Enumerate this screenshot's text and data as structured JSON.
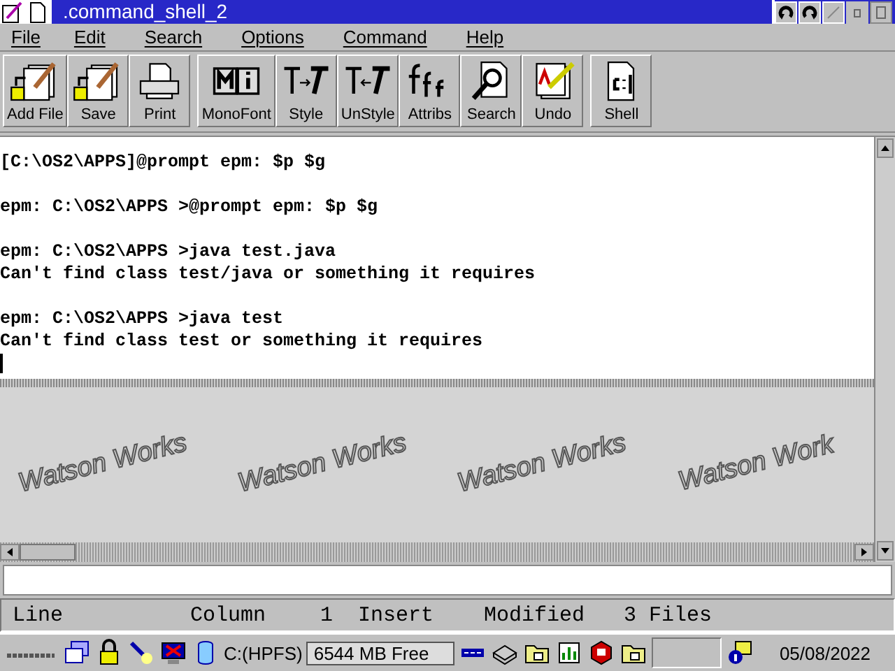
{
  "window": {
    "title": ".command_shell_2"
  },
  "menu": [
    "File",
    "Edit",
    "Search",
    "Options",
    "Command",
    "Help"
  ],
  "toolbar": [
    [
      {
        "label": "Add File",
        "kind": "addfile"
      },
      {
        "label": "Save",
        "kind": "save"
      },
      {
        "label": "Print",
        "kind": "print"
      }
    ],
    [
      {
        "label": "MonoFont",
        "kind": "mono"
      },
      {
        "label": "Style",
        "kind": "style"
      },
      {
        "label": "UnStyle",
        "kind": "unstyle"
      },
      {
        "label": "Attribs",
        "kind": "attribs"
      },
      {
        "label": "Search",
        "kind": "search"
      },
      {
        "label": "Undo",
        "kind": "undo"
      }
    ],
    [
      {
        "label": "Shell",
        "kind": "shell"
      }
    ]
  ],
  "editor": {
    "blocks": [
      [
        "[C:\\OS2\\APPS]@prompt epm: $p $g"
      ],
      [
        "epm: C:\\OS2\\APPS >@prompt epm: $p $g"
      ],
      [
        "epm: C:\\OS2\\APPS >java test.java",
        "Can't find class test/java or something it requires"
      ],
      [
        "epm: C:\\OS2\\APPS >java test",
        "Can't find class test or something it requires"
      ]
    ]
  },
  "background_tiles": [
    "Watson Works",
    "Watson Works",
    "Watson Works",
    "Watson Work"
  ],
  "status_bar": [
    "Line",
    "Column",
    "1",
    "Insert",
    "Modified",
    "3 Files"
  ],
  "taskbar": {
    "items": [
      {
        "kind": "logo"
      },
      {
        "kind": "windows"
      },
      {
        "kind": "lock"
      },
      {
        "kind": "flashlight"
      },
      {
        "kind": "monitor"
      }
    ],
    "drive": {
      "label": "C:(HPFS)",
      "free": "6544 MB Free"
    },
    "tray": [
      {
        "kind": "dots"
      },
      {
        "kind": "disk"
      },
      {
        "kind": "folder"
      },
      {
        "kind": "chart"
      },
      {
        "kind": "shield"
      },
      {
        "kind": "folder"
      }
    ],
    "date": "05/08/2022"
  }
}
